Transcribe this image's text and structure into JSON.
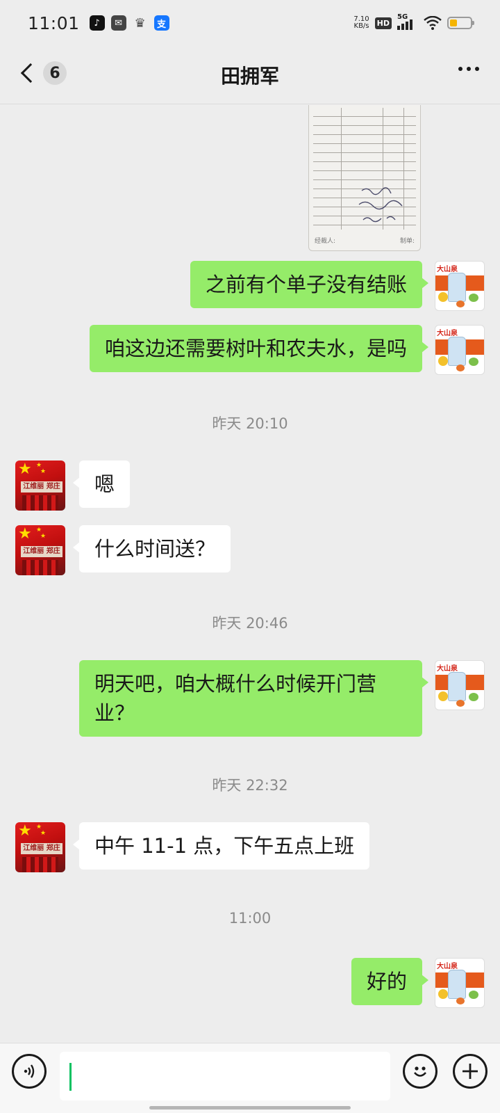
{
  "status_bar": {
    "time": "11:01",
    "net_speed_value": "7.10",
    "net_speed_unit": "KB/s",
    "hd_label": "HD",
    "network_label": "5G",
    "app_icons": [
      "tiktok-icon",
      "mail-icon",
      "crown-icon",
      "alipay-icon"
    ],
    "alipay_glyph": "支",
    "battery_level": 0.35
  },
  "header": {
    "unread_count": "6",
    "title": "田拥军"
  },
  "messages": [
    {
      "type": "image",
      "sender": "me",
      "name": "receipt-photo"
    },
    {
      "type": "text",
      "sender": "me",
      "text": "之前有个单子没有结账"
    },
    {
      "type": "text",
      "sender": "me",
      "text": "咱这边还需要树叶和农夫水，是吗"
    },
    {
      "type": "time",
      "text": "昨天 20:10"
    },
    {
      "type": "text",
      "sender": "them",
      "text": "嗯"
    },
    {
      "type": "text",
      "sender": "them",
      "text": "什么时间送？"
    },
    {
      "type": "time",
      "text": "昨天 20:46"
    },
    {
      "type": "text",
      "sender": "me",
      "text": "明天吧，咱大概什么时候开门营业？"
    },
    {
      "type": "time",
      "text": "昨天 22:32"
    },
    {
      "type": "text",
      "sender": "them",
      "text": "中午 11-1 点，下午五点上班"
    },
    {
      "type": "time",
      "text": "11:00"
    },
    {
      "type": "text",
      "sender": "me",
      "text": "好的"
    }
  ],
  "avatars": {
    "me_brand": "大山泉",
    "them_sign": "江维丽 郑庄"
  },
  "receipt": {
    "signature_name": "田拥军",
    "footer_left": "经裁人:",
    "footer_right": "制单:"
  },
  "input": {
    "placeholder": ""
  },
  "colors": {
    "my_bubble": "#95ec69",
    "their_bubble": "#ffffff",
    "background": "#ededed",
    "caret": "#07c160"
  }
}
